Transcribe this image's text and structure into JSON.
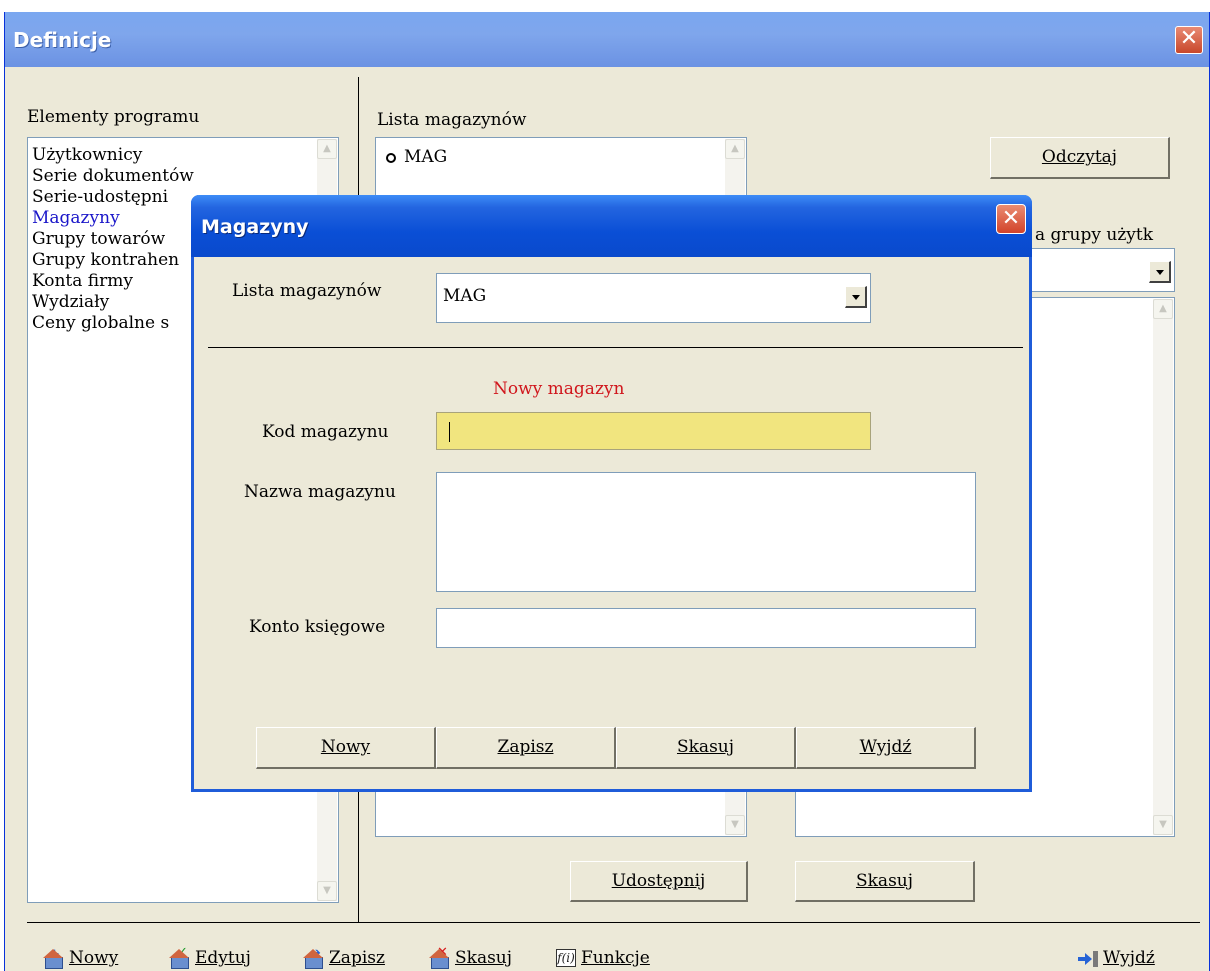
{
  "window": {
    "title": "Definicje",
    "close_glyph": "✕"
  },
  "left_panel": {
    "label": "Elementy programu",
    "items": [
      {
        "label": "Użytkownicy",
        "selected": false
      },
      {
        "label": "Serie dokumentów",
        "selected": false
      },
      {
        "label": "Serie-udostępni",
        "selected": false
      },
      {
        "label": "Magazyny",
        "selected": true
      },
      {
        "label": "Grupy towarów",
        "selected": false
      },
      {
        "label": "Grupy kontrahen",
        "selected": false
      },
      {
        "label": "Konta firmy",
        "selected": false
      },
      {
        "label": "Wydziały",
        "selected": false
      },
      {
        "label": "Ceny globalne s",
        "selected": false
      }
    ]
  },
  "middle_panel": {
    "label": "Lista magazynów",
    "items": [
      {
        "label": "MAG",
        "icon": "radio-icon"
      }
    ],
    "share_button": "Udostępnij"
  },
  "right_panel": {
    "read_button": "Odczytaj",
    "group_label": "a grupy użytk",
    "delete_button": "Skasuj"
  },
  "toolbar": {
    "new": "Nowy",
    "edit": "Edytuj",
    "save": "Zapisz",
    "delete": "Skasuj",
    "functions": "Funkcje",
    "exit": "Wyjdź",
    "functions_icon_text": "f(i)"
  },
  "dialog": {
    "title": "Magazyny",
    "close_glyph": "✕",
    "list_label": "Lista magazynów",
    "list_value": "MAG",
    "status": "Nowy magazyn",
    "status_color": "#d0161c",
    "code_label": "Kod magazynu",
    "code_value": "",
    "name_label": "Nazwa magazynu",
    "name_value": "",
    "account_label": "Konto księgowe",
    "account_value": "",
    "buttons": {
      "new": "Nowy",
      "save": "Zapisz",
      "delete": "Skasuj",
      "exit": "Wyjdź"
    }
  }
}
